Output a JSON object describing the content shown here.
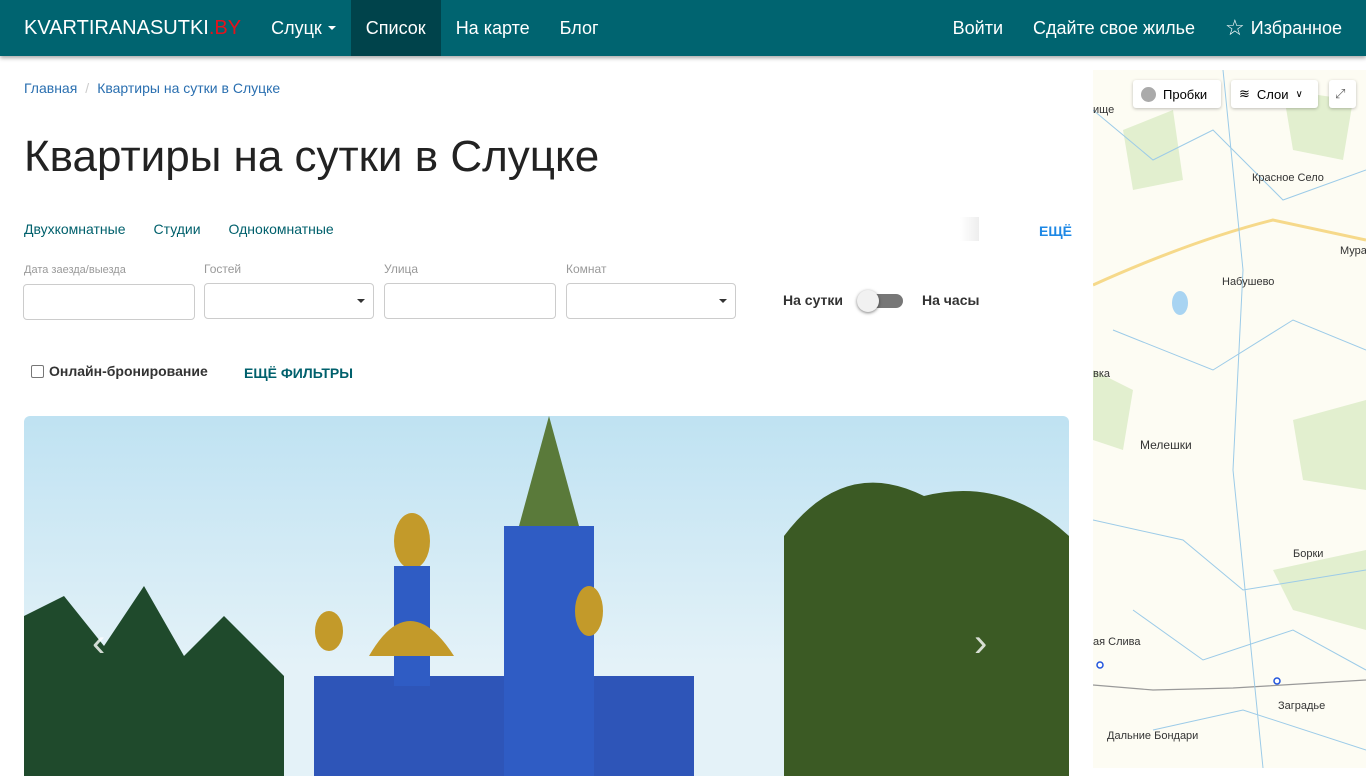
{
  "nav": {
    "brand": "KVARTIRANASUTKI",
    "brand_suffix": ".BY",
    "city": "Слуцк",
    "items": [
      "Список",
      "На карте",
      "Блог"
    ],
    "login": "Войти",
    "rent_out": "Сдайте свое жилье",
    "favorites": "Избранное"
  },
  "breadcrumb": [
    "Главная",
    "Квартиры на сутки в Слуцке"
  ],
  "title": "Квартиры на сутки в Слуцке",
  "quick_filters": [
    "Двухкомнатные",
    "Студии",
    "Однокомнатные"
  ],
  "more": "ЕЩЁ",
  "filters": {
    "dates_label": "Дата заезда/выезда",
    "guests_label": "Гостей",
    "street_label": "Улица",
    "rooms_label": "Комнат",
    "daily": "На сутки",
    "hourly": "На часы",
    "online_booking": "Онлайн-бронирование",
    "more_filters": "ЕЩЁ ФИЛЬТРЫ"
  },
  "map": {
    "traffic": "Пробки",
    "layers": "Слои",
    "places": [
      "ище",
      "Красное Село",
      "Мура",
      "Набушево",
      "вка",
      "Мелешки",
      "Борки",
      "ая Слива",
      "Заградье",
      "Дальние Бондари"
    ]
  }
}
